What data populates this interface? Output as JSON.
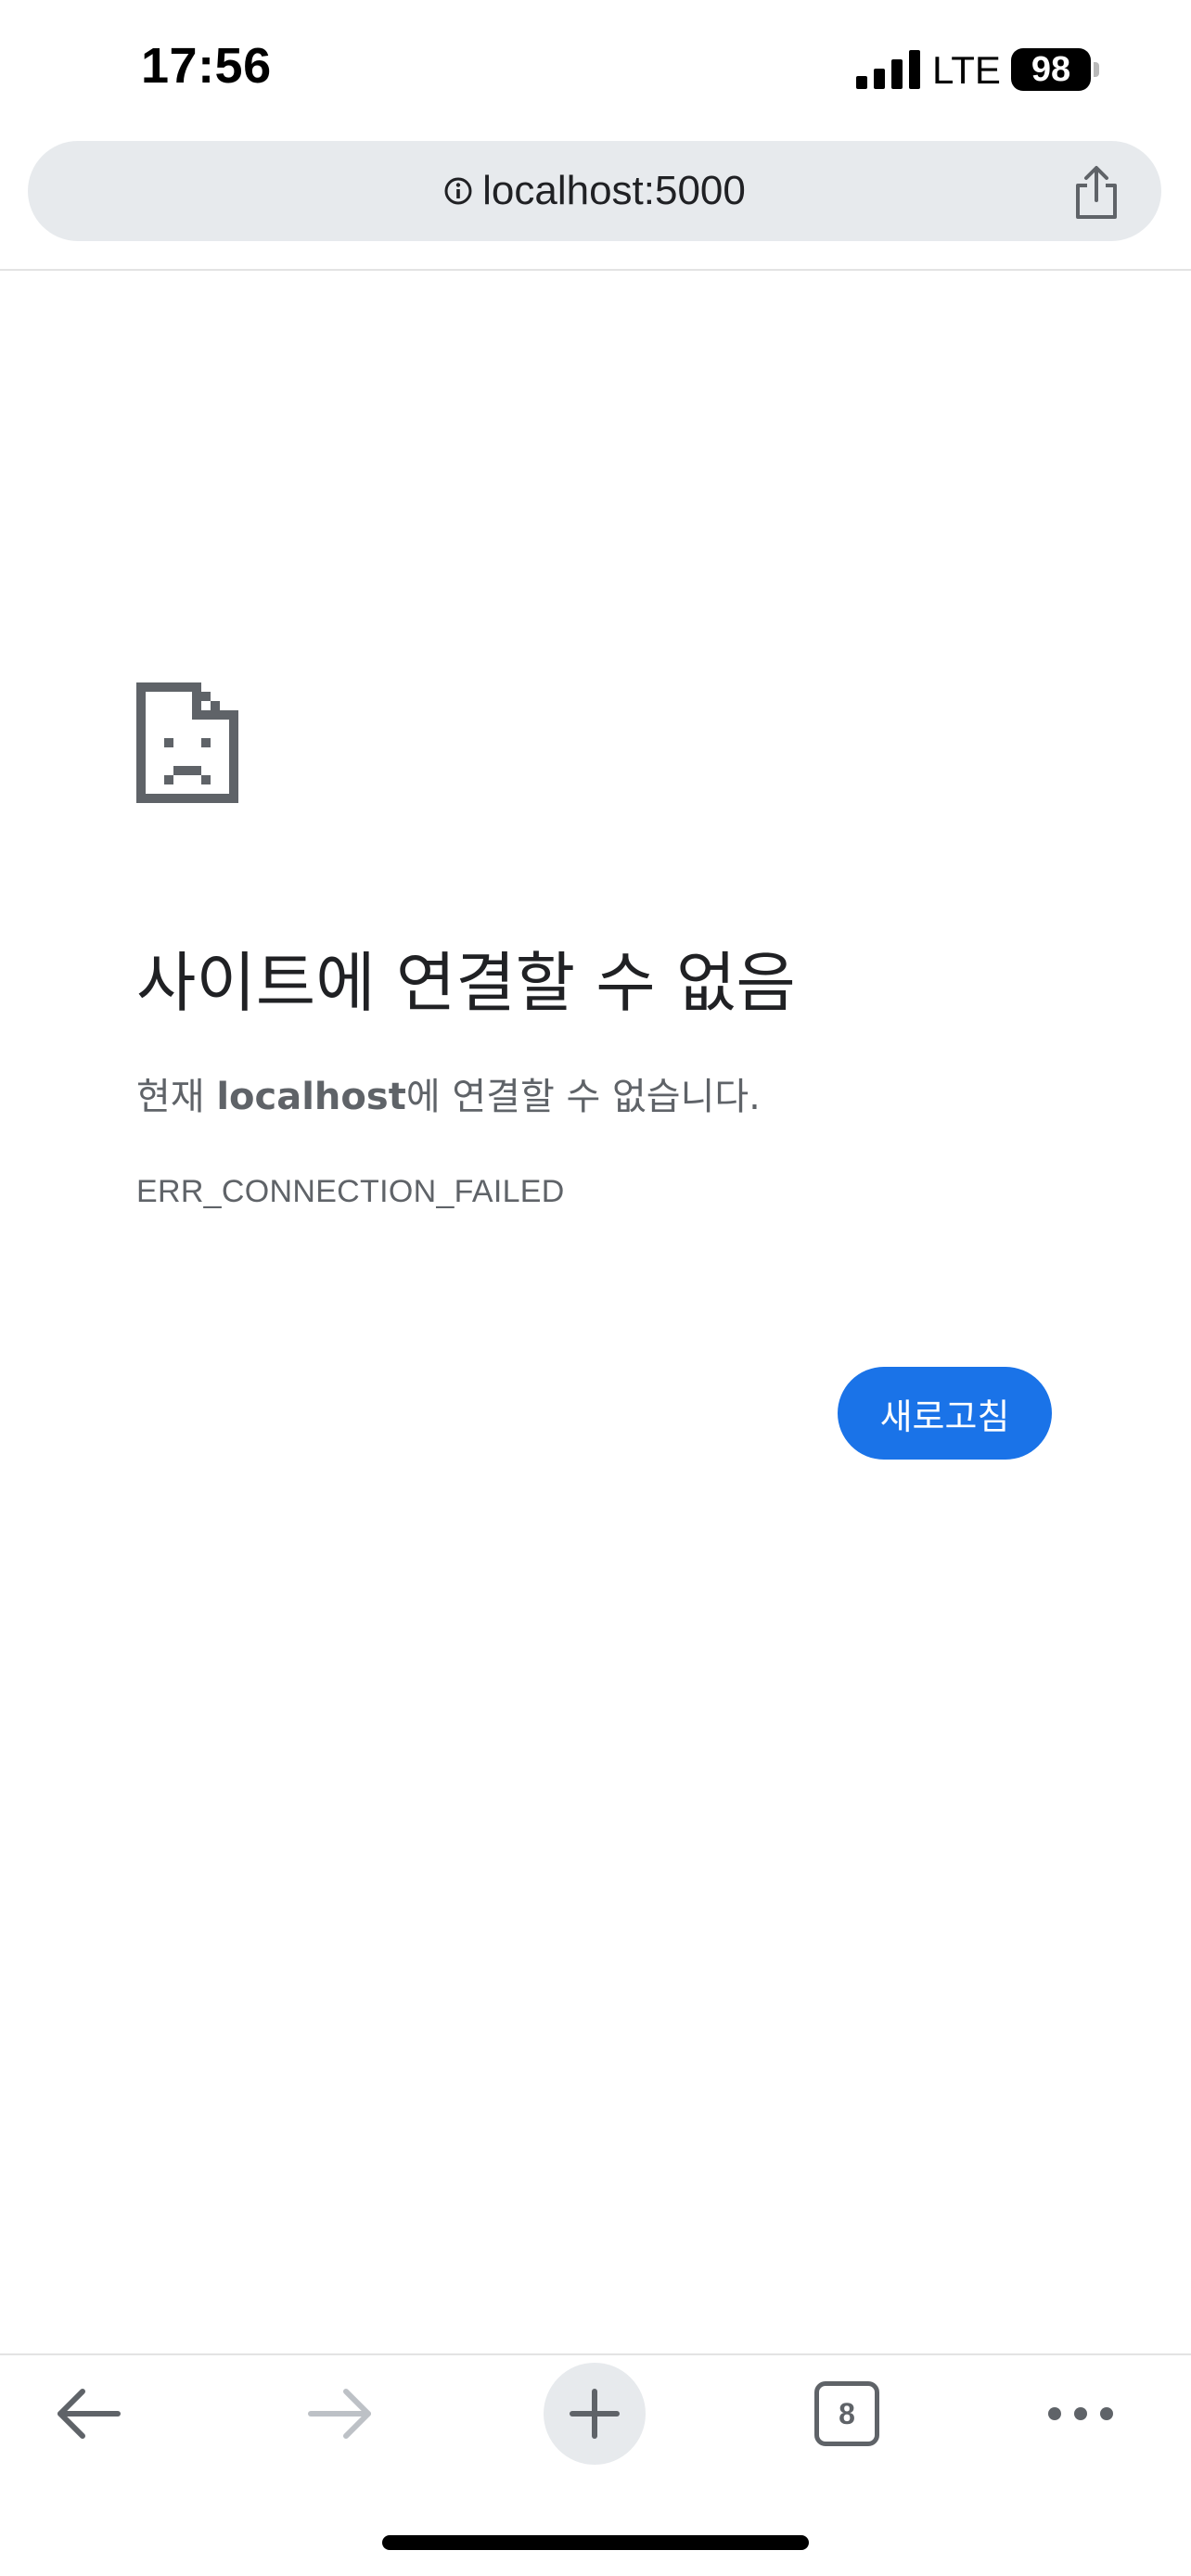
{
  "status_bar": {
    "time": "17:56",
    "network": "LTE",
    "battery": "98"
  },
  "address_bar": {
    "url": "localhost:5000"
  },
  "error": {
    "title": "사이트에 연결할 수 없음",
    "desc_host": "localhost",
    "desc_prefix": "현재 ",
    "desc_suffix": "에 연결할 수 없습니다.",
    "code": "ERR_CONNECTION_FAILED",
    "reload_label": "새로고침"
  },
  "toolbar": {
    "tab_count": "8"
  },
  "colors": {
    "accent": "#1a73e8",
    "address_bar_bg": "#e7eaed",
    "icon_gray": "#5f6368"
  },
  "icons": [
    "signal-icon",
    "info-icon",
    "share-icon",
    "sad-page-icon",
    "back-icon",
    "forward-icon",
    "plus-icon",
    "more-icon"
  ]
}
